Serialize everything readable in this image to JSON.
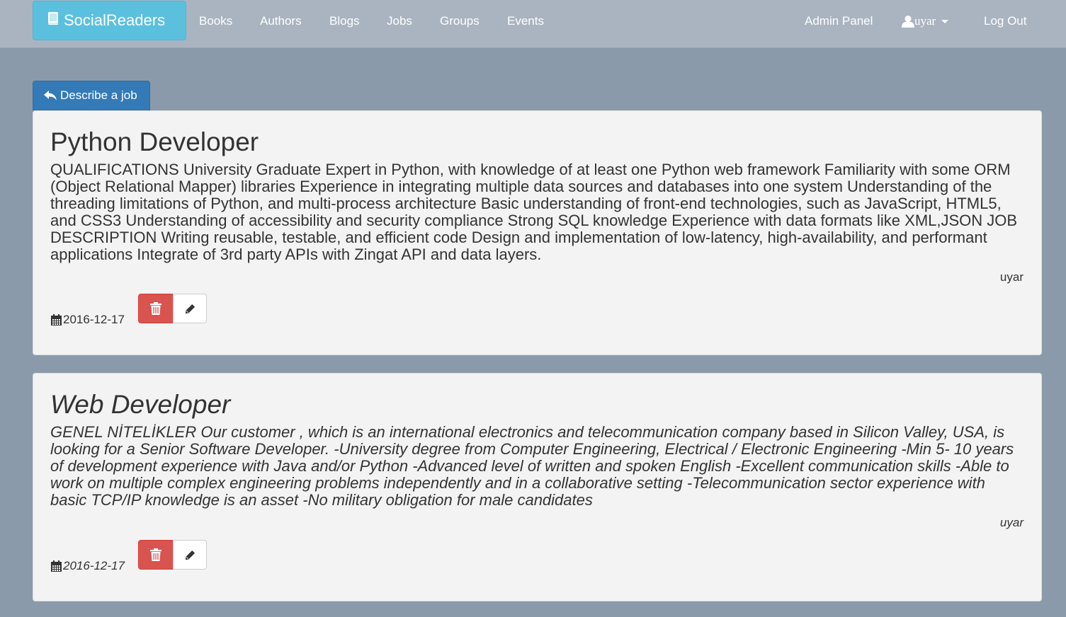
{
  "navbar": {
    "brand": "SocialReaders",
    "links": [
      "Books",
      "Authors",
      "Blogs",
      "Jobs",
      "Groups",
      "Events"
    ],
    "admin_panel": "Admin Panel",
    "user": "uyar",
    "logout": "Log Out"
  },
  "describe_button": "Describe a job",
  "jobs": [
    {
      "title": "Python Developer",
      "description": "QUALIFICATIONS University Graduate Expert in Python, with knowledge of at least one Python web framework Familiarity with some ORM (Object Relational Mapper) libraries Experience in integrating multiple data sources and databases into one system Understanding of the threading limitations of Python, and multi-process architecture Basic understanding of front-end technologies, such as JavaScript, HTML5, and CSS3 Understanding of accessibility and security compliance Strong SQL knowledge Experience with data formats like XML,JSON JOB DESCRIPTION Writing reusable, testable, and efficient code Design and implementation of low-latency, high-availability, and performant applications Integrate of 3rd party APIs with Zingat API and data layers.",
      "author": "uyar",
      "date": "2016-12-17"
    },
    {
      "title": "Web Developer",
      "description": "GENEL NİTELİKLER Our customer , which is an international electronics and telecommunication company based in Silicon Valley, USA, is looking for a Senior Software Developer. -University degree from Computer Engineering, Electrical / Electronic Engineering -Min 5- 10 years of development experience with Java and/or Python -Advanced level of written and spoken English -Excellent communication skills -Able to work on multiple complex engineering problems independently and in a collaborative setting -Telecommunication sector experience with basic TCP/IP knowledge is an asset -No military obligation for male candidates",
      "author": "uyar",
      "date": "2016-12-17"
    }
  ],
  "icons": {
    "brand": "book-icon",
    "user": "user-icon",
    "describe": "reply-icon",
    "date": "calendar-icon",
    "delete": "trash-icon",
    "edit": "pencil-icon"
  },
  "colors": {
    "brand": "#5bc0de",
    "primary": "#337ab7",
    "danger": "#d9534f"
  }
}
